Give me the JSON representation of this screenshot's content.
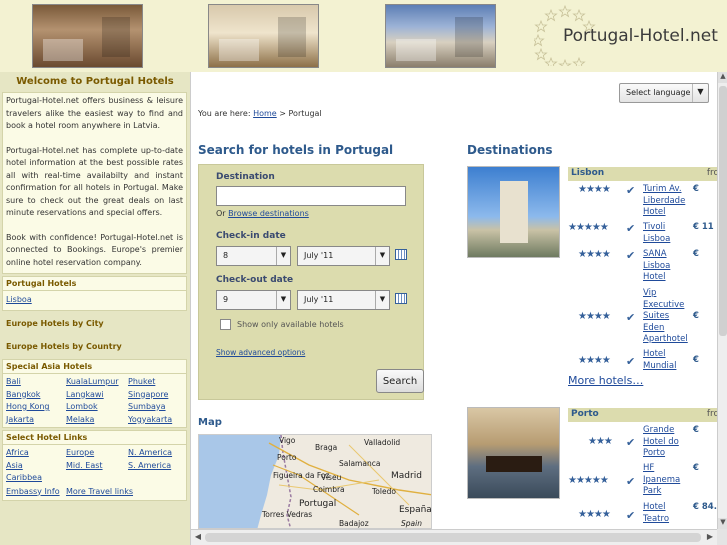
{
  "header": {
    "logo_text": "Portugal-Hotel.net",
    "photos": [
      "hotel-lobby-photo",
      "hotel-room-photo",
      "monument-photo"
    ]
  },
  "sidebar": {
    "welcome_title": "Welcome to Portugal Hotels",
    "welcome_p1": "Portugal-Hotel.net offers business & leisure travelers alike the easiest way to find and book a hotel room anywhere in Latvia.",
    "welcome_p2": "Portugal-Hotel.net has complete up-to-date hotel information at the best possible rates all with real-time availabilty and instant confirmation for all hotels in Portugal. Make sure to check out the great deals on last minute reservations and special offers.",
    "welcome_p3": "Book with confidence! Portugal-Hotel.net is connected to Bookings. Europe's premier online hotel reservation company.",
    "portugal_hotels_title": "Portugal Hotels",
    "portugal_hotels_links": [
      "Lisboa"
    ],
    "europe_city_title": "Europe Hotels by City",
    "europe_country_title": "Europe Hotels by Country",
    "special_asia_title": "Special Asia Hotels",
    "asia_links": [
      "Bali",
      "KualaLumpur",
      "Phuket",
      "Bangkok",
      "Langkawi",
      "Singapore",
      "Hong Kong",
      "Lombok",
      "Sumbaya",
      "Jakarta",
      "Melaka",
      "Yogyakarta"
    ],
    "select_links_title": "Select Hotel Links",
    "select_links": [
      "Africa",
      "Europe",
      "N. America",
      "Asia",
      "Mid. East",
      "S. America",
      "Caribbea"
    ],
    "footer_links": [
      "Embassy Info",
      "More Travel links"
    ]
  },
  "main": {
    "language_select": "Select language",
    "breadcrumb_prefix": "You are here:",
    "breadcrumb_home": "Home",
    "breadcrumb_sep": ">",
    "breadcrumb_current": "Portugal",
    "search_title": "Search for hotels in Portugal",
    "destination_label": "Destination",
    "destination_value": "",
    "browse_or": "Or",
    "browse_link": "Browse destinations",
    "checkin_label": "Check-in date",
    "checkin_day": "8",
    "checkin_month": "July '11",
    "checkout_label": "Check-out date",
    "checkout_day": "9",
    "checkout_month": "July '11",
    "available_only_label": "Show only available hotels",
    "advanced_link": "Show advanced options",
    "search_button": "Search",
    "map_title": "Map",
    "map_labels": [
      "Vigo",
      "Braga",
      "Valladolid",
      "Porto",
      "Salamanca",
      "Figueira da Foz",
      "Viseu",
      "Coimbra",
      "Portugal",
      "Toledo",
      "Madrid",
      "España",
      "Torres Vedras",
      "Badajoz",
      "Spain"
    ],
    "destinations_title": "Destinations",
    "from_label": "fro",
    "cities": [
      {
        "name": "Lisbon",
        "hotels": [
          {
            "stars": "★★★★",
            "name": "Turim Av. Liberdade Hotel",
            "price": "€"
          },
          {
            "stars": "★★★★★",
            "name": "Tivoli Lisboa",
            "price": "€ 11"
          },
          {
            "stars": "★★★★",
            "name": "SANA Lisboa Hotel",
            "price": "€"
          },
          {
            "stars": "★★★★",
            "name": "Vip Executive Suites Eden Aparthotel",
            "price": "€"
          },
          {
            "stars": "★★★★",
            "name": "Hotel Mundial",
            "price": "€"
          }
        ],
        "more": "More hotels…"
      },
      {
        "name": "Porto",
        "hotels": [
          {
            "stars": "★★★",
            "name": "Grande Hotel do Porto",
            "price": "€"
          },
          {
            "stars": "★★★★★",
            "name": "HF Ipanema Park",
            "price": "€"
          },
          {
            "stars": "★★★★",
            "name": "Hotel Teatro",
            "price": "€ 84."
          }
        ]
      }
    ]
  }
}
